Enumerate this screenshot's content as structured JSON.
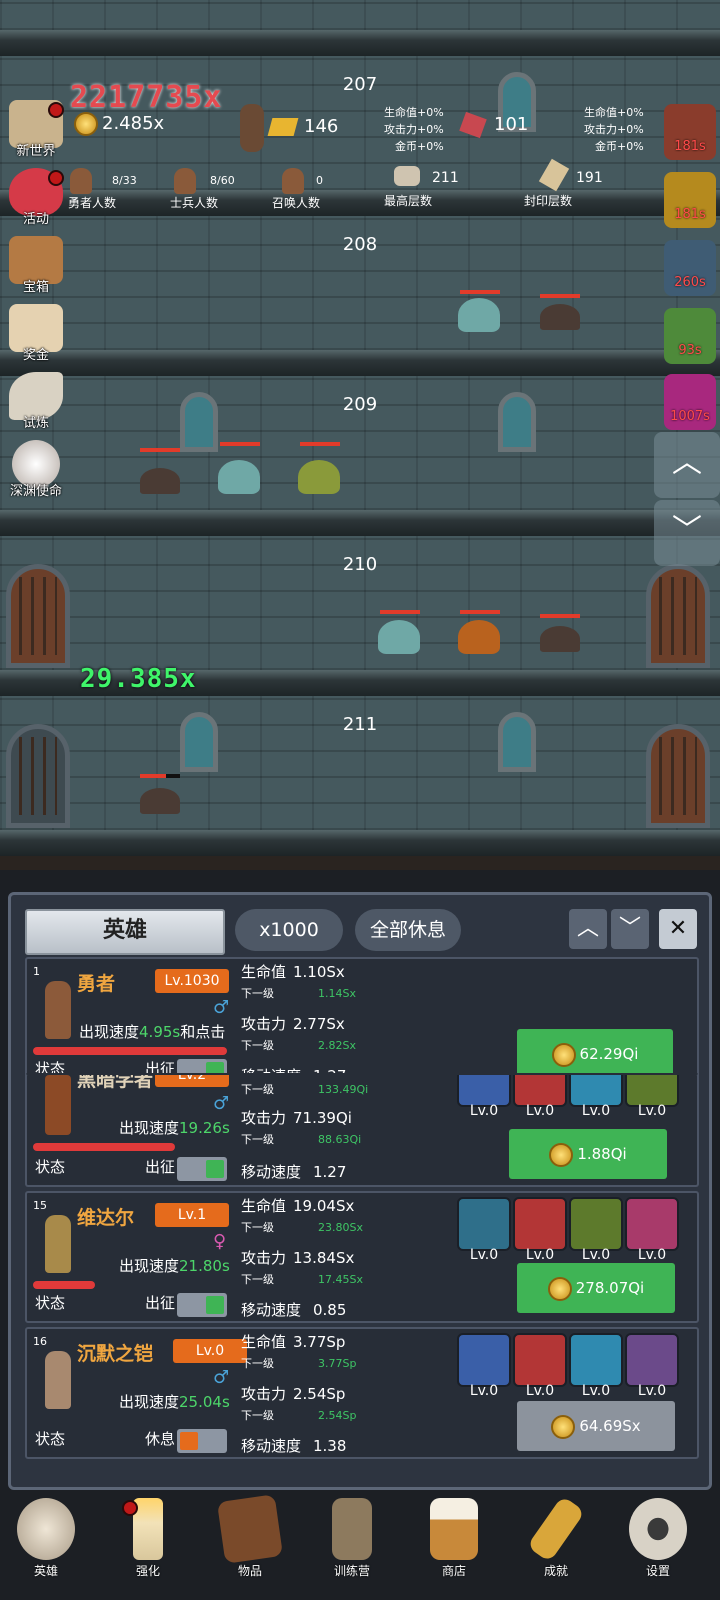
{
  "floors": [
    {
      "number": "207"
    },
    {
      "number": "208"
    },
    {
      "number": "209"
    },
    {
      "number": "210"
    },
    {
      "number": "211"
    }
  ],
  "floating_texts": {
    "damage_top": "2217735x",
    "damage_green": "29.385x"
  },
  "hud": {
    "gold": "2.485x",
    "bars": "146",
    "gems": "101",
    "bonus_left": [
      "生命值+0%",
      "攻击力+0%",
      "金币+0%"
    ],
    "bonus_right": [
      "生命值+0%",
      "攻击力+0%",
      "金币+0%"
    ],
    "hero_count": {
      "value": "8/33",
      "label": "勇者人数"
    },
    "soldier_count": {
      "value": "8/60",
      "label": "士兵人数"
    },
    "summon_count": {
      "value": "0",
      "label": "召唤人数"
    },
    "highest_floor": {
      "value": "211",
      "label": "最高层数"
    },
    "sealed_floor": {
      "value": "191",
      "label": "封印层数"
    }
  },
  "left_menu": [
    {
      "label": "新世界",
      "icon": "map-icon",
      "dot": true
    },
    {
      "label": "活动",
      "icon": "heart-icon",
      "dot": true
    },
    {
      "label": "宝箱",
      "icon": "chest-icon",
      "dot": false
    },
    {
      "label": "奖金",
      "icon": "envelope-icon",
      "dot": false
    },
    {
      "label": "试炼",
      "icon": "feather-icon",
      "dot": false
    },
    {
      "label": "深渊使命",
      "icon": "orb-icon",
      "dot": false
    }
  ],
  "right_timers": [
    "181s",
    "181s",
    "260s",
    "93s",
    "1007s"
  ],
  "panel": {
    "tab_label": "英雄",
    "multiplier": "x1000",
    "rest_all": "全部休息",
    "state_label": "状态",
    "sortie_label": "出征",
    "rest_label": "休息",
    "hp_label": "生命值",
    "atk_label": "攻击力",
    "next_label": "下一级",
    "move_label": "移动速度",
    "speed_prefix": "出现速度"
  },
  "heroes": [
    {
      "idx": "1",
      "name": "勇者",
      "lv": "Lv.1030",
      "gender": "♂",
      "speed": "4.95s",
      "speed_suffix": "和点击",
      "hp": "1.10Sx",
      "hp_next": "1.14Sx",
      "atk": "2.77Sx",
      "atk_next": "2.82Sx",
      "move": "1.27",
      "cost": "62.29Qi",
      "active": true,
      "hp_fill": 1.0
    },
    {
      "idx": "",
      "name": "黑暗学者",
      "lv": "Lv.2",
      "gender": "♂",
      "speed": "19.26s",
      "speed_suffix": "",
      "hp_next": "133.49Qi",
      "atk": "71.39Qi",
      "atk_next": "88.63Qi",
      "move": "1.27",
      "cost": "1.88Qi",
      "active": true,
      "hp_fill": 0.73,
      "skills": [
        {
          "icon": "fire-arm-icon",
          "lv": "Lv.0"
        },
        {
          "icon": "sword-icon",
          "lv": "Lv.0"
        },
        {
          "icon": "wing-boot-icon",
          "lv": "Lv.0"
        },
        {
          "icon": "ranger-icon",
          "lv": "Lv.0"
        }
      ]
    },
    {
      "idx": "15",
      "name": "维达尔",
      "lv": "Lv.1",
      "gender": "♀",
      "speed": "21.80s",
      "speed_suffix": "",
      "hp": "19.04Sx",
      "hp_next": "23.80Sx",
      "atk": "13.84Sx",
      "atk_next": "17.45Sx",
      "move": "0.85",
      "cost": "278.07Qi",
      "active": true,
      "hp_fill": 0.32,
      "skills": [
        {
          "icon": "poison-shield-icon",
          "lv": "Lv.0"
        },
        {
          "icon": "sword-icon",
          "lv": "Lv.0"
        },
        {
          "icon": "dual-sword-icon",
          "lv": "Lv.0"
        },
        {
          "icon": "boot-icon",
          "lv": "Lv.0"
        }
      ]
    },
    {
      "idx": "16",
      "name": "沉默之铠",
      "lv": "Lv.0",
      "gender": "♂",
      "speed": "25.04s",
      "speed_suffix": "",
      "hp": "3.77Sp",
      "hp_next": "3.77Sp",
      "atk": "2.54Sp",
      "atk_next": "2.54Sp",
      "move": "1.38",
      "cost": "64.69Sx",
      "active": false,
      "hp_fill": 0,
      "skills": [
        {
          "icon": "shield-icon",
          "lv": "Lv.0"
        },
        {
          "icon": "sword-icon",
          "lv": "Lv.0"
        },
        {
          "icon": "gauntlet-icon",
          "lv": "Lv.0"
        },
        {
          "icon": "assassin-icon",
          "lv": "Lv.0"
        }
      ]
    }
  ],
  "nav": [
    {
      "label": "英雄",
      "icon": "skull-icon",
      "dot": false
    },
    {
      "label": "强化",
      "icon": "candle-icon",
      "dot": true
    },
    {
      "label": "物品",
      "icon": "book-icon",
      "dot": false
    },
    {
      "label": "训练营",
      "icon": "lantern-icon",
      "dot": false
    },
    {
      "label": "商店",
      "icon": "beer-icon",
      "dot": false
    },
    {
      "label": "成就",
      "icon": "key-icon",
      "dot": false
    },
    {
      "label": "设置",
      "icon": "gear-icon",
      "dot": false
    }
  ]
}
